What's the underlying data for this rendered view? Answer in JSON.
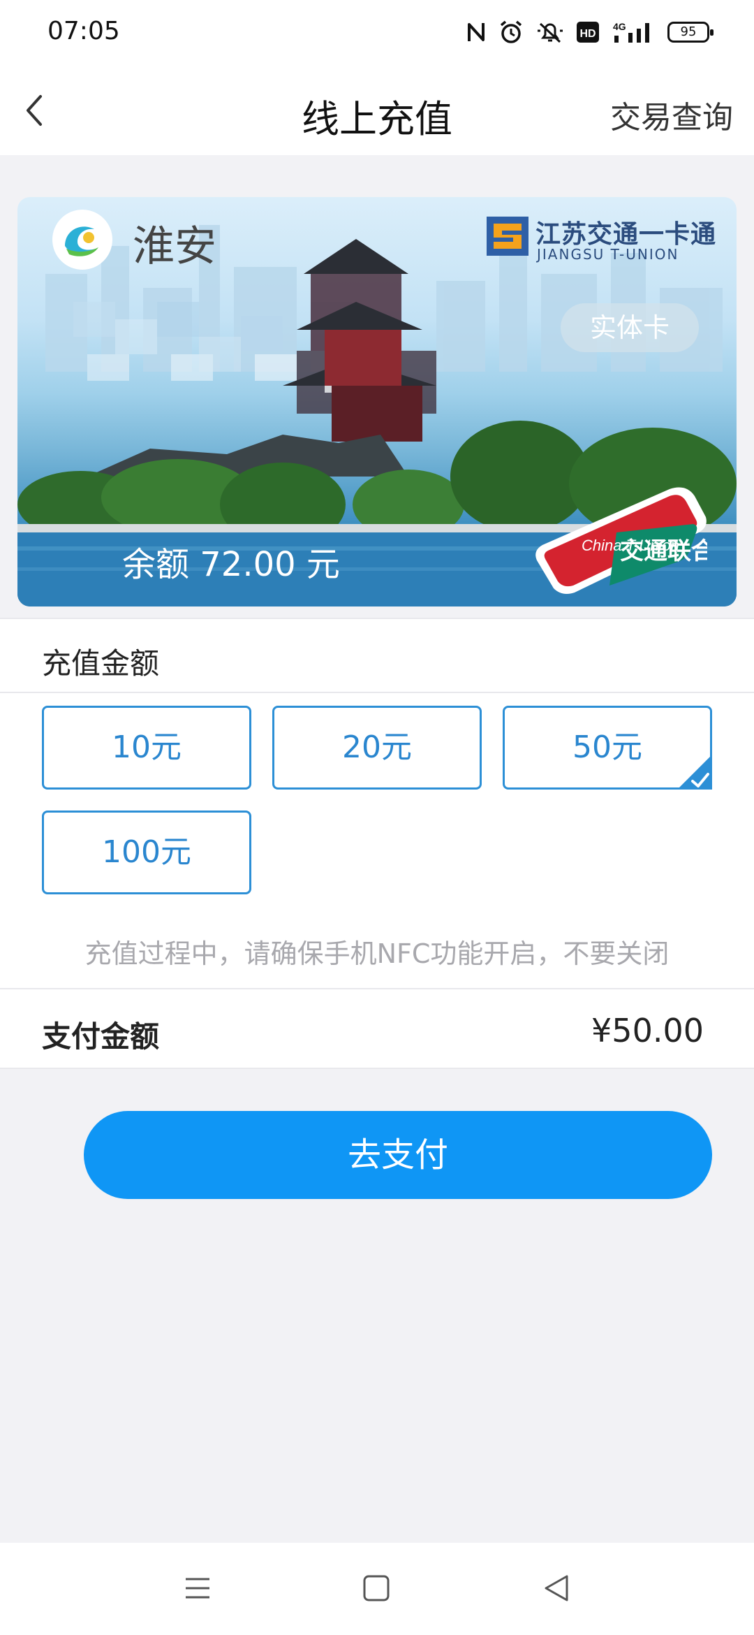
{
  "status_bar": {
    "time": "07:05",
    "network": "4G",
    "battery": "95",
    "hd_label": "HD"
  },
  "header": {
    "back_icon": "chevron-left-icon",
    "title": "线上充值",
    "right_action": "交易查询"
  },
  "card": {
    "city": "淮安",
    "brand_cn": "江苏交通一卡通",
    "brand_en": "JIANGSU T-UNION",
    "card_type": "实体卡",
    "balance": "余额 72.00 元",
    "china_tunion_cn": "交通联合",
    "china_tunion_en": "China T-Union"
  },
  "recharge": {
    "section_label": "充值金额",
    "options": [
      "10元",
      "20元",
      "50元",
      "100元"
    ],
    "selected": "50元",
    "tip": "充值过程中，请确保手机NFC功能开启，不要关闭"
  },
  "payment": {
    "label": "支付金额",
    "amount": "¥50.00",
    "button": "去支付"
  },
  "colors": {
    "accent": "#2c8fd6",
    "primary_button": "#0f96f5",
    "page_bg": "#f2f2f5"
  }
}
